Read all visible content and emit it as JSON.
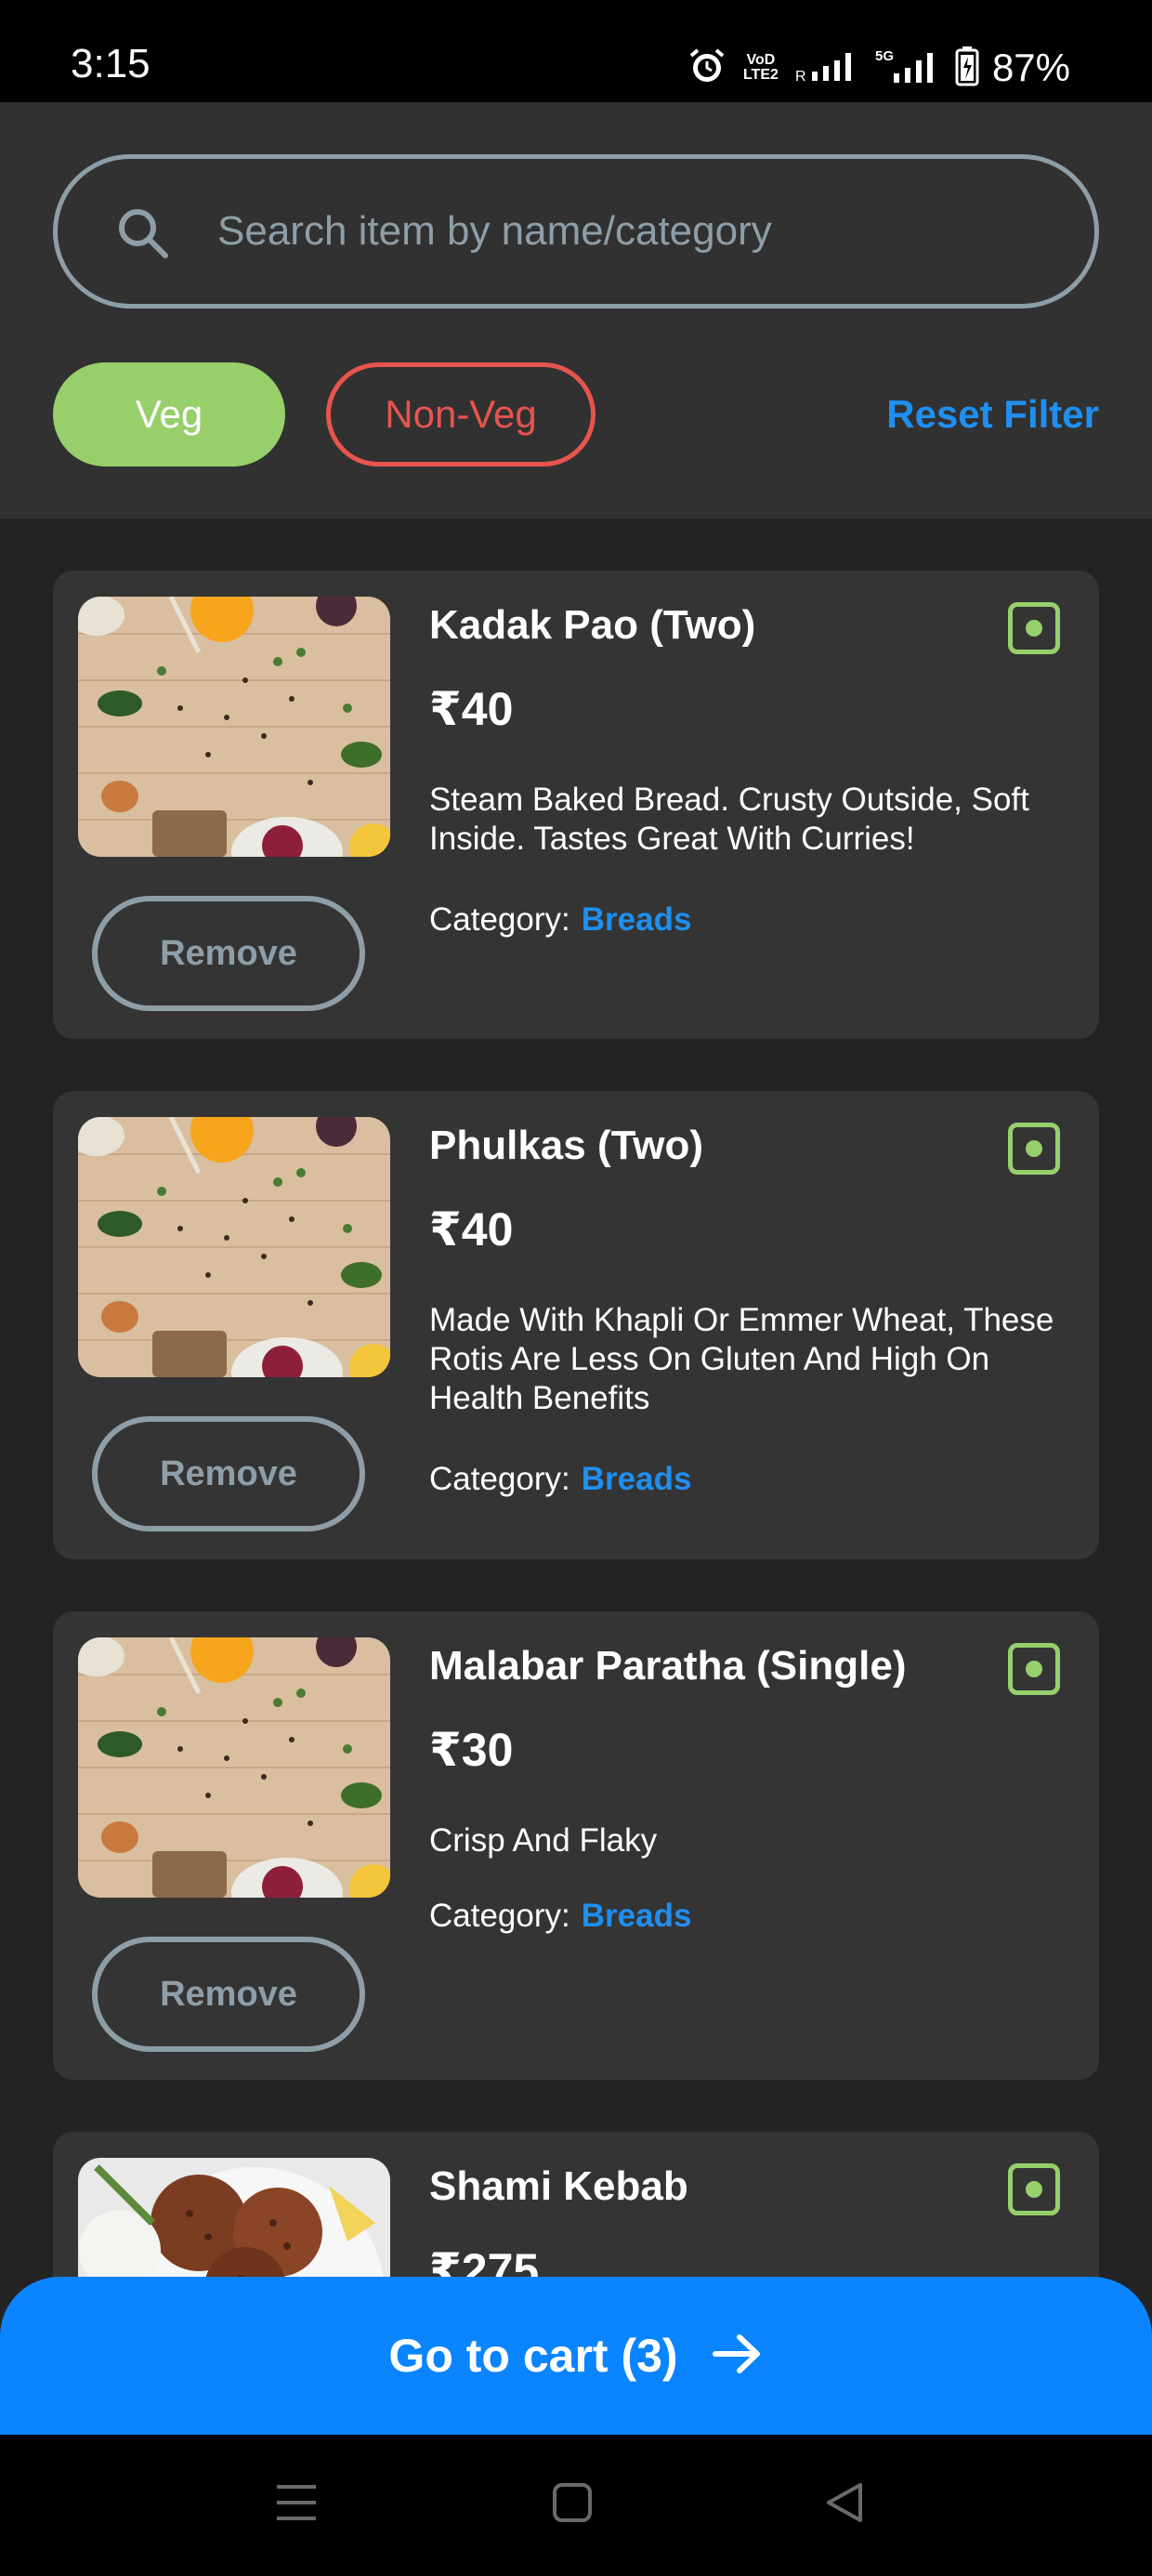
{
  "status_bar": {
    "time": "3:15",
    "volte_label": "VoD LTE2",
    "roaming_label": "R",
    "network_label": "5G",
    "battery": "87%"
  },
  "search": {
    "placeholder": "Search item by name/category",
    "value": ""
  },
  "filters": {
    "veg_label": "Veg",
    "nonveg_label": "Non-Veg",
    "reset_label": "Reset Filter"
  },
  "colors": {
    "background": "#232323",
    "panel": "#313131",
    "card": "#343434",
    "veg_green": "#97cf6a",
    "nonveg_red": "#e8544e",
    "link_blue": "#1f8ff0",
    "cart_blue": "#0a84ff",
    "outline_grey": "#8e9ea8"
  },
  "items": [
    {
      "name": "Kadak Pao (Two)",
      "price": "₹40",
      "description": "Steam Baked Bread. Crusty Outside, Soft Inside. Tastes Great With Curries!",
      "category_label": "Category:",
      "category": "Breads",
      "remove_label": "Remove",
      "veg": true
    },
    {
      "name": "Phulkas (Two)",
      "price": "₹40",
      "description": "Made With Khapli Or Emmer Wheat, These Rotis Are Less On Gluten And High On Health Benefits",
      "category_label": "Category:",
      "category": "Breads",
      "remove_label": "Remove",
      "veg": true
    },
    {
      "name": "Malabar Paratha (Single)",
      "price": "₹30",
      "description": "Crisp And Flaky",
      "category_label": "Category:",
      "category": "Breads",
      "remove_label": "Remove",
      "veg": true
    },
    {
      "name": "Shami Kebab",
      "price": "₹275",
      "veg": true
    }
  ],
  "cart": {
    "label": "Go to cart (3)",
    "icon": "arrow-right-icon"
  },
  "navigation": {
    "icons": [
      "menu-icon",
      "home-square-icon",
      "back-triangle-icon"
    ]
  }
}
